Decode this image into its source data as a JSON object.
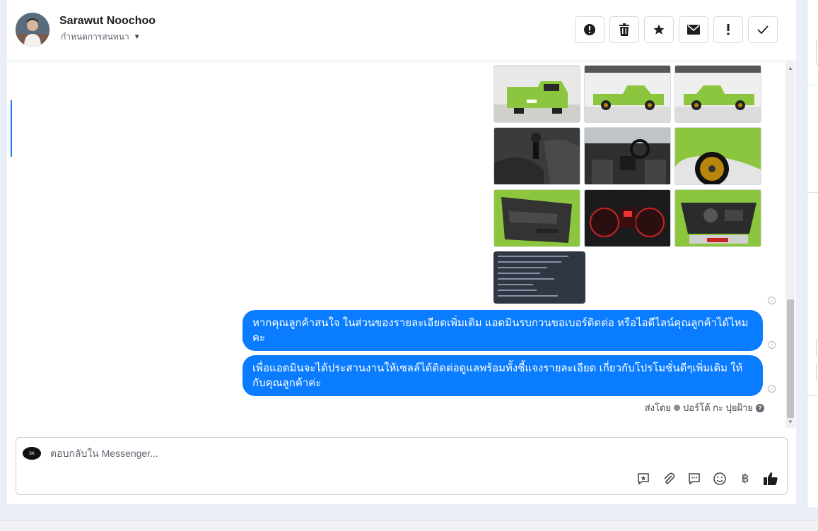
{
  "header": {
    "contact_name": "Sarawut Noochoo",
    "assign_label": "กำหนดการสนทนา",
    "actions": [
      {
        "name": "spam-button",
        "icon": "alert-circle-icon"
      },
      {
        "name": "delete-button",
        "icon": "trash-icon"
      },
      {
        "name": "star-button",
        "icon": "star-icon"
      },
      {
        "name": "mark-unread-button",
        "icon": "envelope-icon"
      },
      {
        "name": "follow-up-button",
        "icon": "exclamation-icon"
      },
      {
        "name": "mark-done-button",
        "icon": "checkmark-icon"
      }
    ]
  },
  "messages": {
    "photos": [
      {
        "name": "photo-rear-view"
      },
      {
        "name": "photo-side-view"
      },
      {
        "name": "photo-side-view-2"
      },
      {
        "name": "photo-gear-shift"
      },
      {
        "name": "photo-dashboard"
      },
      {
        "name": "photo-wheel"
      },
      {
        "name": "photo-door-panel"
      },
      {
        "name": "photo-gauge-cluster"
      },
      {
        "name": "photo-engine-bay"
      },
      {
        "name": "photo-spec-sheet"
      }
    ],
    "bubble_1": "หากคุณลูกค้าสนใจ ในส่วนของรายละเอียดเพิ่มเติม แอดมินรบกวนขอเบอร์ติดต่อ หรือไอดีไลน์คุณลูกค้าได้ไหมคะ",
    "bubble_2": "เพื่อแอดมินจะได้ประสานงานให้เซลล์ได้ติดต่อดูแลพร้อมทั้งชี้แจงรายละเอียด เกี่ยวกับโปรโมชั่นดีๆเพิ่มเติม ให้กับคุณลูกค้าค่ะ",
    "sent_by_prefix": "ส่งโดย",
    "sent_by_name": "ปอร์โต้ กะ ปุยฝ้าย"
  },
  "composer": {
    "placeholder": "ตอบกลับใน Messenger...",
    "tools": [
      "saved-reply-icon",
      "attachment-icon",
      "message-icon",
      "emoji-icon",
      "baht-icon",
      "like-icon"
    ]
  },
  "colors": {
    "bubble": "#0a7cff",
    "accent": "#1877f2",
    "car_green": "#8cc63f"
  }
}
